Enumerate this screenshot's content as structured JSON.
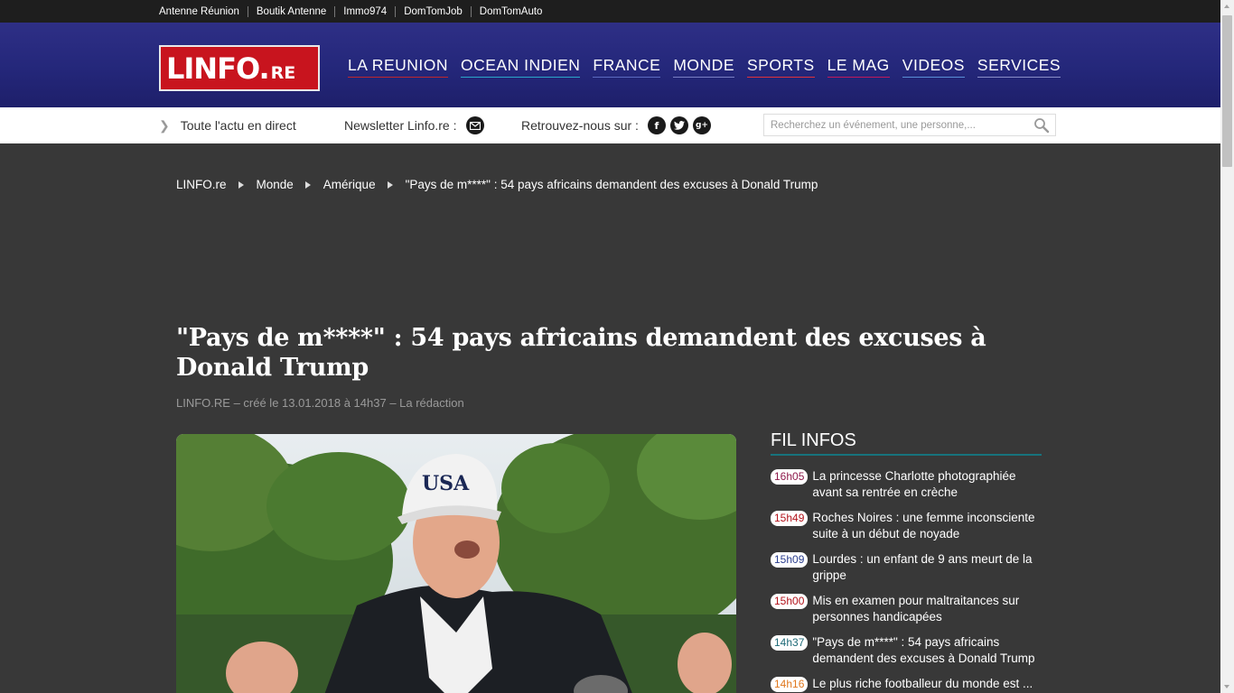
{
  "topbar": {
    "links": [
      "Antenne Réunion",
      "Boutik Antenne",
      "Immo974",
      "DomTomJob",
      "DomTomAuto"
    ]
  },
  "logo": {
    "main": "LINFO.",
    "suffix": "RE"
  },
  "nav": {
    "items": [
      {
        "label": "LA REUNION",
        "underline": "#c0272d"
      },
      {
        "label": "OCEAN INDIEN",
        "underline": "#2aa7c9"
      },
      {
        "label": "FRANCE",
        "underline": "#5c6bc0"
      },
      {
        "label": "MONDE",
        "underline": "#7a7fc4"
      },
      {
        "label": "SPORTS",
        "underline": "#e0323b"
      },
      {
        "label": "LE MAG",
        "underline": "#c2185b"
      },
      {
        "label": "VIDEOS",
        "underline": "#5a8fd6"
      },
      {
        "label": "SERVICES",
        "underline": "#8a8ec8"
      }
    ]
  },
  "subbar": {
    "live_label": "Toute l'actu en direct",
    "newsletter_label": "Newsletter Linfo.re :",
    "follow_label": "Retrouvez-nous sur :",
    "search_placeholder": "Recherchez un événement, une personne,..."
  },
  "breadcrumb": {
    "items": [
      "LINFO.re",
      "Monde",
      "Amérique",
      "\"Pays de m****\" : 54 pays africains demandent des excuses à Donald Trump"
    ]
  },
  "article": {
    "title": "\"Pays de m****\" : 54 pays africains demandent des excuses à Donald Trump",
    "meta": "LINFO.RE – créé le 13.01.2018 à 14h37 – La rédaction"
  },
  "fil_infos": {
    "title": "FIL INFOS",
    "items": [
      {
        "time": "16h05",
        "text": "La princesse Charlotte photographiée avant sa rentrée en crèche",
        "color": "#8e1a4b"
      },
      {
        "time": "15h49",
        "text": "Roches Noires : une femme inconsciente suite à un début de noyade",
        "color": "#b3141c"
      },
      {
        "time": "15h09",
        "text": "Lourdes : un enfant de 9 ans meurt de la grippe",
        "color": "#2c3f8f"
      },
      {
        "time": "15h00",
        "text": "Mis en examen pour maltraitances sur personnes handicapées",
        "color": "#b3141c"
      },
      {
        "time": "14h37",
        "text": "\"Pays de m****\" : 54 pays africains demandent des excuses à Donald Trump",
        "color": "#1f6b78"
      },
      {
        "time": "14h16",
        "text": "Le plus riche footballeur du monde est ...",
        "color": "#e0781e"
      }
    ]
  }
}
